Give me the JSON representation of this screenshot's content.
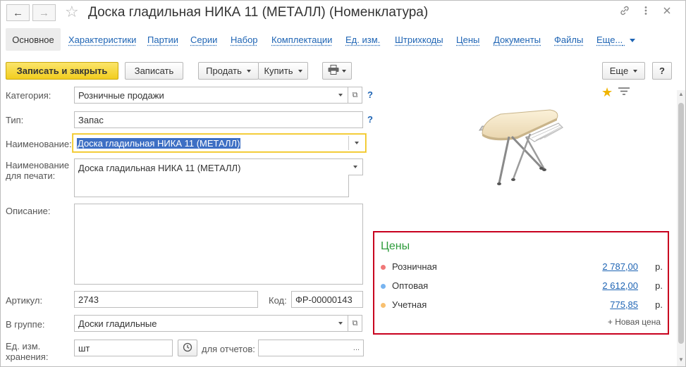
{
  "window": {
    "title": "Доска гладильная  НИКА 11 (МЕТАЛЛ) (Номенклатура)",
    "link_icon": "link-icon",
    "menu_icon": "more-vertical-icon",
    "close_icon": "close-icon",
    "back_icon": "arrow-left-icon",
    "forward_icon": "arrow-right-icon",
    "favorite_icon": "star-outline-icon"
  },
  "tabs": {
    "active": "Основное",
    "items": [
      "Характеристики",
      "Партии",
      "Серии",
      "Набор",
      "Комплектации",
      "Ед. изм.",
      "Штрихкоды",
      "Цены",
      "Документы",
      "Файлы",
      "Еще..."
    ]
  },
  "toolbar": {
    "save_close": "Записать и закрыть",
    "save": "Записать",
    "sell": "Продать",
    "buy": "Купить",
    "more": "Еще",
    "help": "?",
    "print_icon": "printer-icon"
  },
  "form": {
    "category_label": "Категория:",
    "category_value": "Розничные продажи",
    "type_label": "Тип:",
    "type_value": "Запас",
    "name_label": "Наименование:",
    "name_value": "Доска гладильная  НИКА 11 (МЕТАЛЛ)",
    "print_name_label_1": "Наименование",
    "print_name_label_2": "для печати:",
    "print_name_value": "Доска гладильная  НИКА 11 (МЕТАЛЛ)",
    "description_label": "Описание:",
    "description_value": "",
    "article_label": "Артикул:",
    "article_value": "2743",
    "code_label": "Код:",
    "code_value": "ФР-00000143",
    "group_label": "В группе:",
    "group_value": "Доски гладильные",
    "unit_label_1": "Ед. изм.",
    "unit_label_2": "хранения:",
    "unit_value": "шт",
    "reports_label": "для отчетов:",
    "reports_value": "",
    "help_mark": "?"
  },
  "prices": {
    "title": "Цены",
    "rows": [
      {
        "name": "Розничная",
        "value": "2 787,00",
        "currency": "р.",
        "color": "#f07878"
      },
      {
        "name": "Оптовая",
        "value": "2 612,00",
        "currency": "р.",
        "color": "#78b4f0"
      },
      {
        "name": "Учетная",
        "value": "775,85",
        "currency": "р.",
        "color": "#f8c070"
      }
    ],
    "new_price": "+ Новая цена"
  },
  "colors": {
    "accent_yellow": "#f2cd1f",
    "link_blue": "#1e64b4",
    "prices_border": "#c8001e",
    "prices_title": "#2e9c3c",
    "favorite_star": "#f0b400"
  }
}
